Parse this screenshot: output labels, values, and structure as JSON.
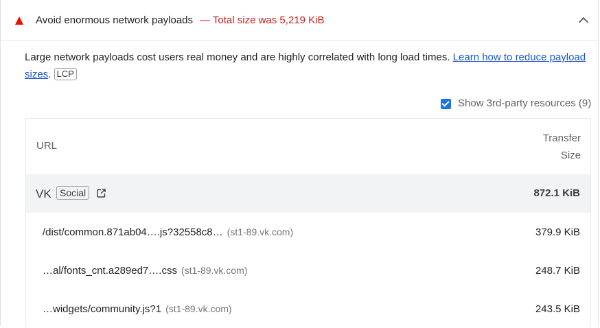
{
  "audit": {
    "title": "Avoid enormous network payloads",
    "summary": "— Total size was 5,219 KiB",
    "status_icon": "fail-triangle-icon",
    "expand_icon": "chevron-up-icon"
  },
  "description": {
    "text": "Large network payloads cost users real money and are highly correlated with long load times. ",
    "link_text": "Learn how to reduce payload sizes",
    "after_link": ".",
    "metric_chip": "LCP"
  },
  "third_party": {
    "checked": true,
    "label": "Show 3rd-party resources (9)"
  },
  "table": {
    "headers": {
      "url": "URL",
      "size_line1": "Transfer",
      "size_line2": "Size"
    },
    "group": {
      "name": "VK",
      "chip": "Social",
      "icon": "external-link-icon",
      "size": "872.1 KiB"
    },
    "rows": [
      {
        "url": "/dist/common.871ab04….js?32558c8…",
        "host": "(st1-89.vk.com)",
        "size": "379.9 KiB"
      },
      {
        "url": "…al/fonts_cnt.a289ed7….css",
        "host": "(st1-89.vk.com)",
        "size": "248.7 KiB"
      },
      {
        "url": "…widgets/community.js?1",
        "host": "(st1-89.vk.com)",
        "size": "243.5 KiB"
      }
    ]
  },
  "colors": {
    "fail": "#eb0f00",
    "summary": "#c5221f",
    "link": "#1a55c7",
    "checkbox": "#1a73e8",
    "group_bg": "#f1f3f4"
  }
}
